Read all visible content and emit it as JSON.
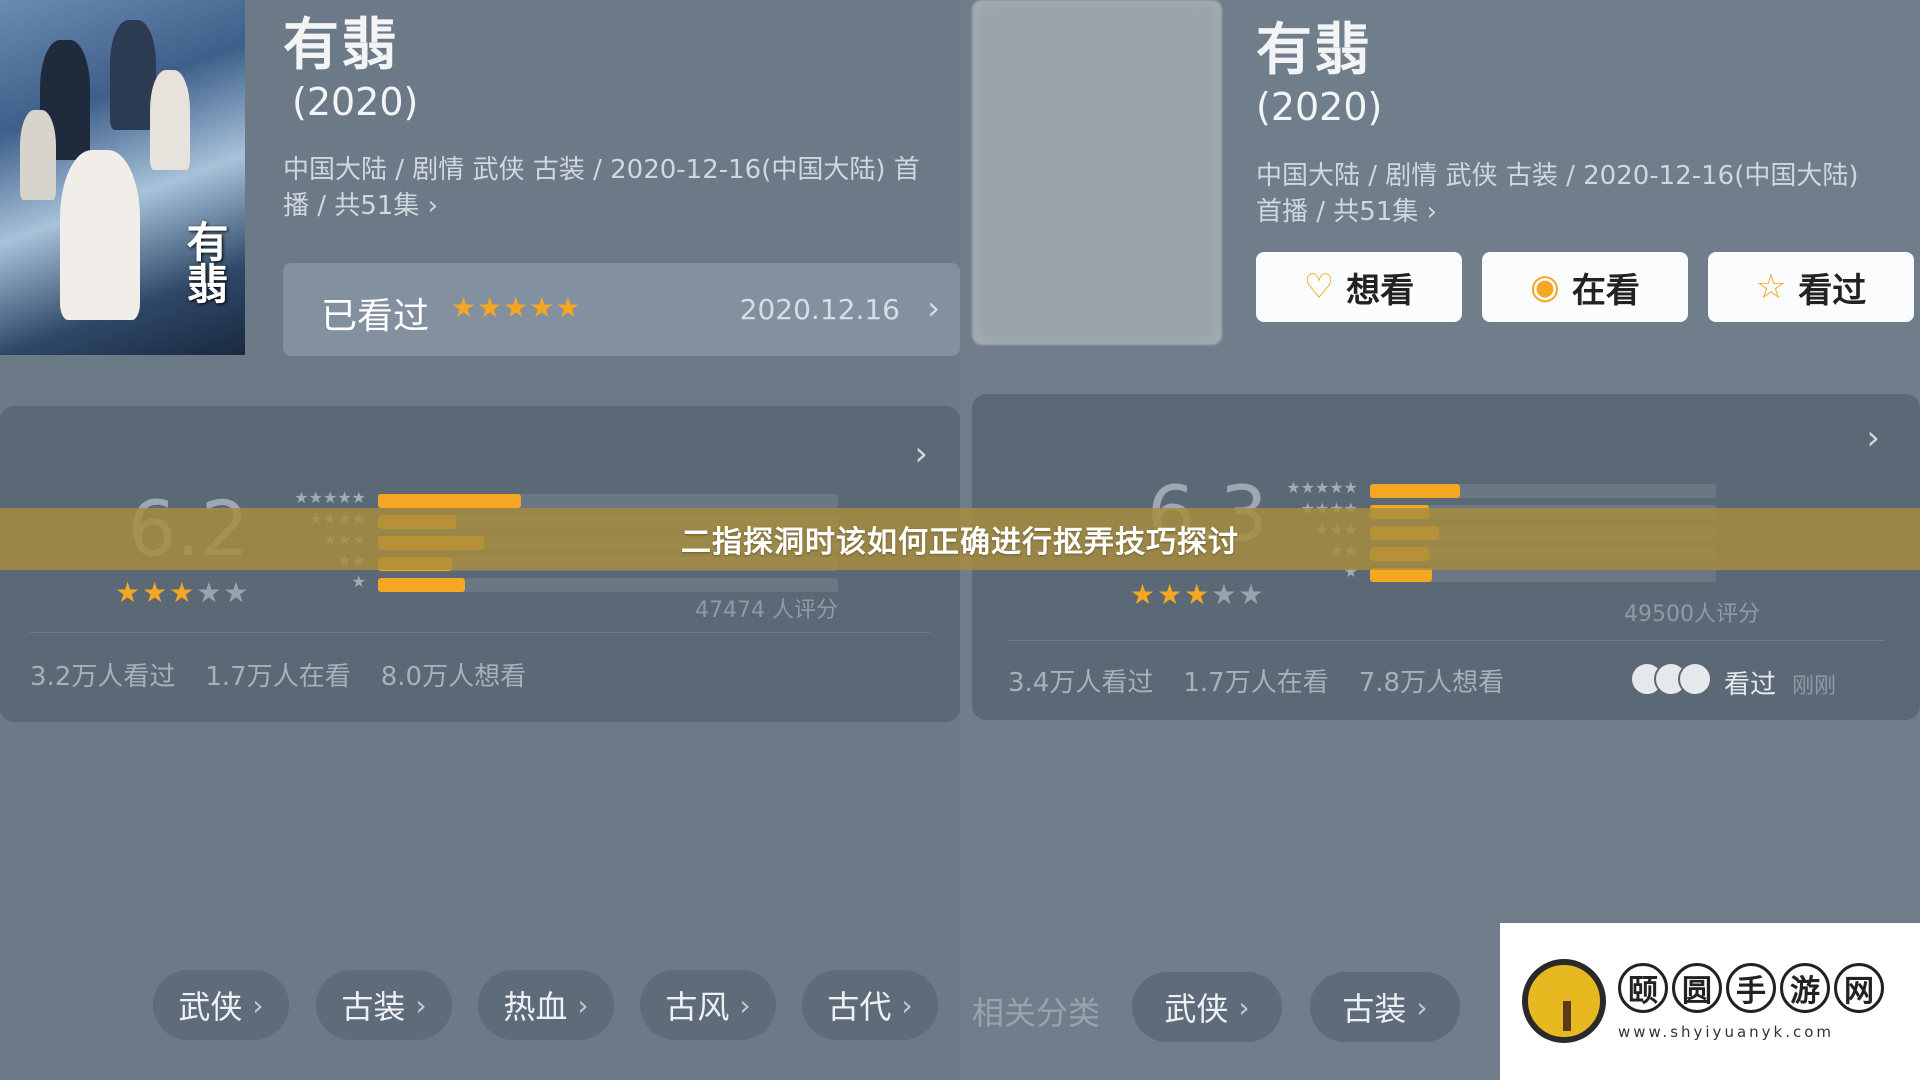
{
  "left": {
    "title": "有翡",
    "year": "(2020)",
    "meta_line1": "中国大陆 / 剧情 武侠 古装 / 2020-12-16(中国大陆) 首",
    "meta_line2": "播 / 共51集 ›",
    "poster_text": "有翡",
    "watched": {
      "label": "已看过",
      "stars": "★★★★★",
      "date": "2020.12.16",
      "chevron": "›"
    },
    "rating": {
      "score": "6.2",
      "stars_on": "★★★",
      "stars_off": "★★",
      "distribution": [
        {
          "label": "★★★★★",
          "fraction": 0.31
        },
        {
          "label": "★★★★",
          "fraction": 0.17
        },
        {
          "label": "★★★",
          "fraction": 0.23
        },
        {
          "label": "★★",
          "fraction": 0.16
        },
        {
          "label": "★",
          "fraction": 0.19
        }
      ],
      "count": "47474 人评分",
      "stats": [
        "3.2万人看过",
        "1.7万人在看",
        "8.0万人想看"
      ]
    },
    "tags": [
      {
        "label": "武侠"
      },
      {
        "label": "古装"
      },
      {
        "label": "热血"
      },
      {
        "label": "古风"
      },
      {
        "label": "古代"
      }
    ]
  },
  "right": {
    "title": "有翡",
    "year": "(2020)",
    "meta_line1": "中国大陆 / 剧情 武侠 古装 / 2020-12-16(中国大陆)",
    "meta_line2": "首播 / 共51集 ›",
    "buttons": [
      {
        "label": "想看",
        "icon": "heart-plus-icon",
        "glyph": "♡"
      },
      {
        "label": "在看",
        "icon": "target-icon",
        "glyph": "◉"
      },
      {
        "label": "看过",
        "icon": "star-outline-icon",
        "glyph": "☆"
      }
    ],
    "rating": {
      "score": "6.3",
      "stars_on": "★★★",
      "stars_off": "★★",
      "distribution": [
        {
          "label": "★★★★★",
          "fraction": 0.26
        },
        {
          "label": "★★★★",
          "fraction": 0.17
        },
        {
          "label": "★★★",
          "fraction": 0.2
        },
        {
          "label": "★★",
          "fraction": 0.17
        },
        {
          "label": "★",
          "fraction": 0.18
        }
      ],
      "count": "49500人评分",
      "stats": [
        "3.4万人看过",
        "1.7万人在看",
        "7.8万人想看"
      ],
      "seen_label": "看过",
      "seen_time": "刚刚"
    },
    "related_label": "相关分类",
    "tags": [
      {
        "label": "武侠"
      },
      {
        "label": "古装"
      }
    ]
  },
  "banner": {
    "text": "二指探洞时该如何正确进行抠弄技巧探讨"
  },
  "watermark": {
    "chars": [
      "颐",
      "圆",
      "手",
      "游",
      "网"
    ],
    "url": "www.shyiyuanyk.com"
  },
  "colors": {
    "accent": "#f5a623",
    "banner": "#a88c3c"
  }
}
